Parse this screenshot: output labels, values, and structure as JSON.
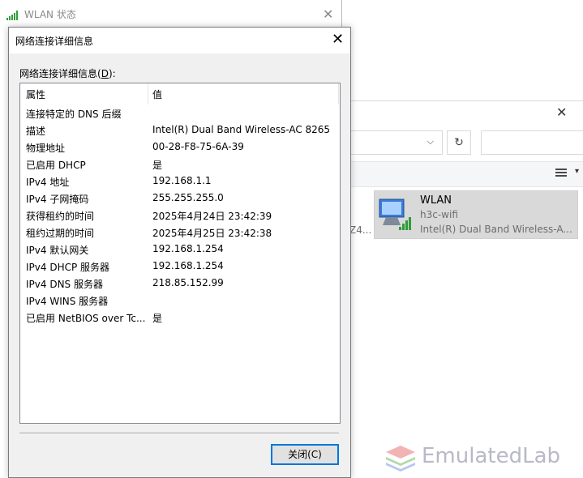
{
  "status_window": {
    "title": "WLAN 状态",
    "close": "✕"
  },
  "explorer": {
    "close": "✕",
    "dropdown_chevron": "⌵",
    "refresh": "↻",
    "partial_text": "Z4...",
    "view_chevron": "▾",
    "adapter": {
      "name": "WLAN",
      "ssid": "h3c-wifi",
      "description": "Intel(R) Dual Band Wireless-A..."
    }
  },
  "dialog": {
    "title": "网络连接详细信息",
    "close": "✕",
    "list_label_prefix": "网络连接详细信息(",
    "list_label_key": "D",
    "list_label_suffix": "):",
    "columns": {
      "property": "属性",
      "value": "值"
    },
    "rows": [
      {
        "property": "连接特定的 DNS 后缀",
        "value": ""
      },
      {
        "property": "描述",
        "value": "Intel(R) Dual Band Wireless-AC 8265"
      },
      {
        "property": "物理地址",
        "value": "00-28-F8-75-6A-39"
      },
      {
        "property": "已启用 DHCP",
        "value": "是"
      },
      {
        "property": "IPv4 地址",
        "value": "192.168.1.1"
      },
      {
        "property": "IPv4 子网掩码",
        "value": "255.255.255.0"
      },
      {
        "property": "获得租约的时间",
        "value": "2025年4月24日 23:42:39"
      },
      {
        "property": "租约过期的时间",
        "value": "2025年4月25日 23:42:38"
      },
      {
        "property": "IPv4 默认网关",
        "value": "192.168.1.254"
      },
      {
        "property": "IPv4 DHCP 服务器",
        "value": "192.168.1.254"
      },
      {
        "property": "IPv4 DNS 服务器",
        "value": "218.85.152.99"
      },
      {
        "property": "IPv4 WINS 服务器",
        "value": ""
      },
      {
        "property": "已启用 NetBIOS over Tc...",
        "value": "是"
      }
    ],
    "close_button": "关闭(C)"
  },
  "watermark": {
    "text": "EmulatedLab"
  },
  "colors": {
    "accent": "#0078d7",
    "signal": "#2e9d3a"
  }
}
